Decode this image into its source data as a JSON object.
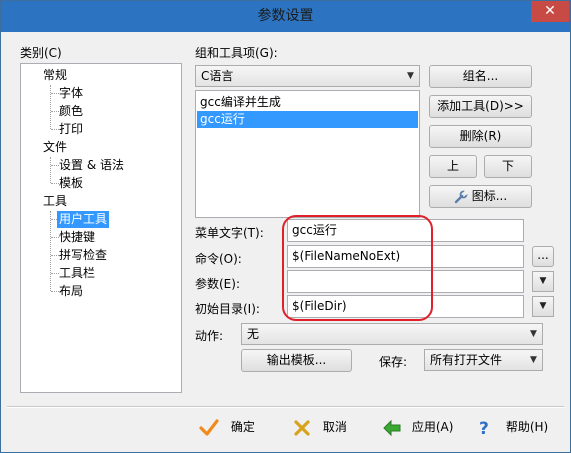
{
  "window": {
    "title": "参数设置",
    "close_glyph": "✕"
  },
  "category": {
    "label": "类别(C)",
    "tree": [
      {
        "label": "常规",
        "level": 0
      },
      {
        "label": "字体",
        "level": 1
      },
      {
        "label": "颜色",
        "level": 1
      },
      {
        "label": "打印",
        "level": 1
      },
      {
        "label": "文件",
        "level": 0
      },
      {
        "label": "设置 & 语法",
        "level": 1
      },
      {
        "label": "模板",
        "level": 1
      },
      {
        "label": "工具",
        "level": 0
      },
      {
        "label": "用户工具",
        "level": 1,
        "selected": true
      },
      {
        "label": "快捷键",
        "level": 1
      },
      {
        "label": "拼写检查",
        "level": 1
      },
      {
        "label": "工具栏",
        "level": 1
      },
      {
        "label": "布局",
        "level": 1
      }
    ]
  },
  "groups": {
    "label": "组和工具项(G):",
    "selected_group": "C语言",
    "items": [
      {
        "label": "gcc编译并生成",
        "selected": false
      },
      {
        "label": "gcc运行",
        "selected": true
      }
    ]
  },
  "side_buttons": {
    "group_name": "组名...",
    "add_tool": "添加工具(D)>>",
    "delete": "删除(R)",
    "up": "上",
    "down": "下",
    "icon": "图标..."
  },
  "form": {
    "menu_text_label": "菜单文字(T):",
    "menu_text_value": "gcc运行",
    "command_label": "命令(O):",
    "command_value": "$(FileNameNoExt)",
    "command_browse": "...",
    "params_label": "参数(E):",
    "params_value": "",
    "init_dir_label": "初始目录(I):",
    "init_dir_value": "$(FileDir)",
    "action_label": "动作:",
    "action_value": "无",
    "output_template": "输出模板...",
    "save_label": "保存:",
    "save_value": "所有打开文件"
  },
  "footer": {
    "ok": "确定",
    "cancel": "取消",
    "apply": "应用(A)",
    "help": "帮助(H)"
  },
  "colors": {
    "titlebar": "#2c74c2",
    "close": "#c74b44",
    "selection": "#3399ff",
    "annotation": "#e0202a"
  }
}
